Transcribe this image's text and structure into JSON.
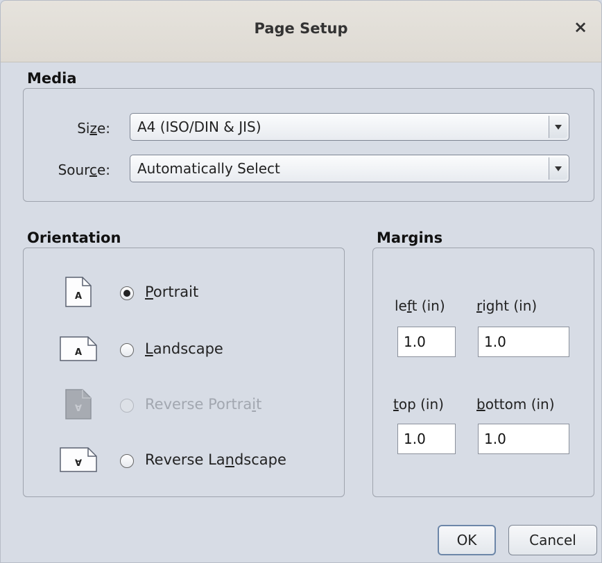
{
  "dialog": {
    "title": "Page Setup",
    "close_glyph": "×"
  },
  "media": {
    "heading": "Media",
    "size": {
      "label_pre": "Si",
      "label_u": "z",
      "label_post": "e:",
      "value": "A4 (ISO/DIN & JIS)"
    },
    "source": {
      "label_pre": "Sour",
      "label_u": "c",
      "label_post": "e:",
      "value": "Automatically Select"
    }
  },
  "orientation": {
    "heading": "Orientation",
    "options": [
      {
        "pre": "",
        "u": "P",
        "post": "ortrait",
        "checked": true,
        "disabled": false,
        "icon": "portrait-page-icon"
      },
      {
        "pre": "",
        "u": "L",
        "post": "andscape",
        "checked": false,
        "disabled": false,
        "icon": "landscape-page-icon"
      },
      {
        "pre": "Reverse Portra",
        "u": "i",
        "post": "t",
        "checked": false,
        "disabled": true,
        "icon": "reverse-portrait-page-icon"
      },
      {
        "pre": "Reverse La",
        "u": "n",
        "post": "dscape",
        "checked": false,
        "disabled": false,
        "icon": "reverse-landscape-page-icon"
      }
    ],
    "icon_letter": "A",
    "icon_letter_reversed": "∀"
  },
  "margins": {
    "heading": "Margins",
    "left": {
      "pre": "le",
      "u": "f",
      "post": "t (in)",
      "value": "1.0"
    },
    "right": {
      "pre": "",
      "u": "r",
      "post": "ight (in)",
      "value": "1.0"
    },
    "top": {
      "pre": "",
      "u": "t",
      "post": "op (in)",
      "value": "1.0"
    },
    "bottom": {
      "pre": "",
      "u": "b",
      "post": "ottom (in)",
      "value": "1.0"
    }
  },
  "buttons": {
    "ok": "OK",
    "cancel": "Cancel"
  },
  "colors": {
    "background": "#d7dce5",
    "titlebar": "#e2dfd9",
    "border": "#9ea3ad",
    "disabled_text": "#a2a7b0"
  }
}
